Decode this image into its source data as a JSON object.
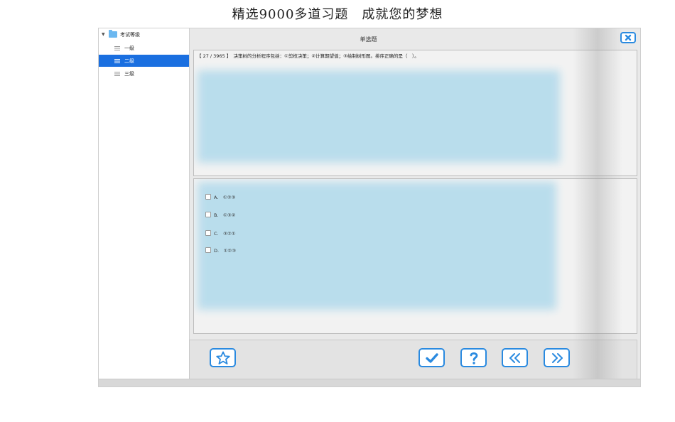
{
  "banner": "精选9000多道习题　成就您的梦想",
  "sidebar": {
    "root_label": "考试等级",
    "items": [
      {
        "label": "一级"
      },
      {
        "label": "二级"
      },
      {
        "label": "三级"
      }
    ],
    "selected_index": 1
  },
  "header": {
    "title": "单选题"
  },
  "question": {
    "text": "【 27 / 3965 】　决策树的分析程序包括：①剪枝决策；②计算期望值；③绘制树形图。排序正确的是（　）。"
  },
  "options": [
    {
      "label": "A.　①②③"
    },
    {
      "label": "B.　①③②"
    },
    {
      "label": "C.　③②①"
    },
    {
      "label": "D.　①②③"
    }
  ],
  "toolbar": {
    "buttons": [
      {
        "icon": "star-icon"
      },
      {
        "icon": "check-icon"
      },
      {
        "icon": "question-icon"
      },
      {
        "icon": "previous-icon"
      },
      {
        "icon": "next-icon"
      }
    ]
  },
  "colors": {
    "accent": "#2a8ae0",
    "selection": "#1a6fe0",
    "folder": "#6cb8f0",
    "blurred_content": "#b7dcec"
  }
}
